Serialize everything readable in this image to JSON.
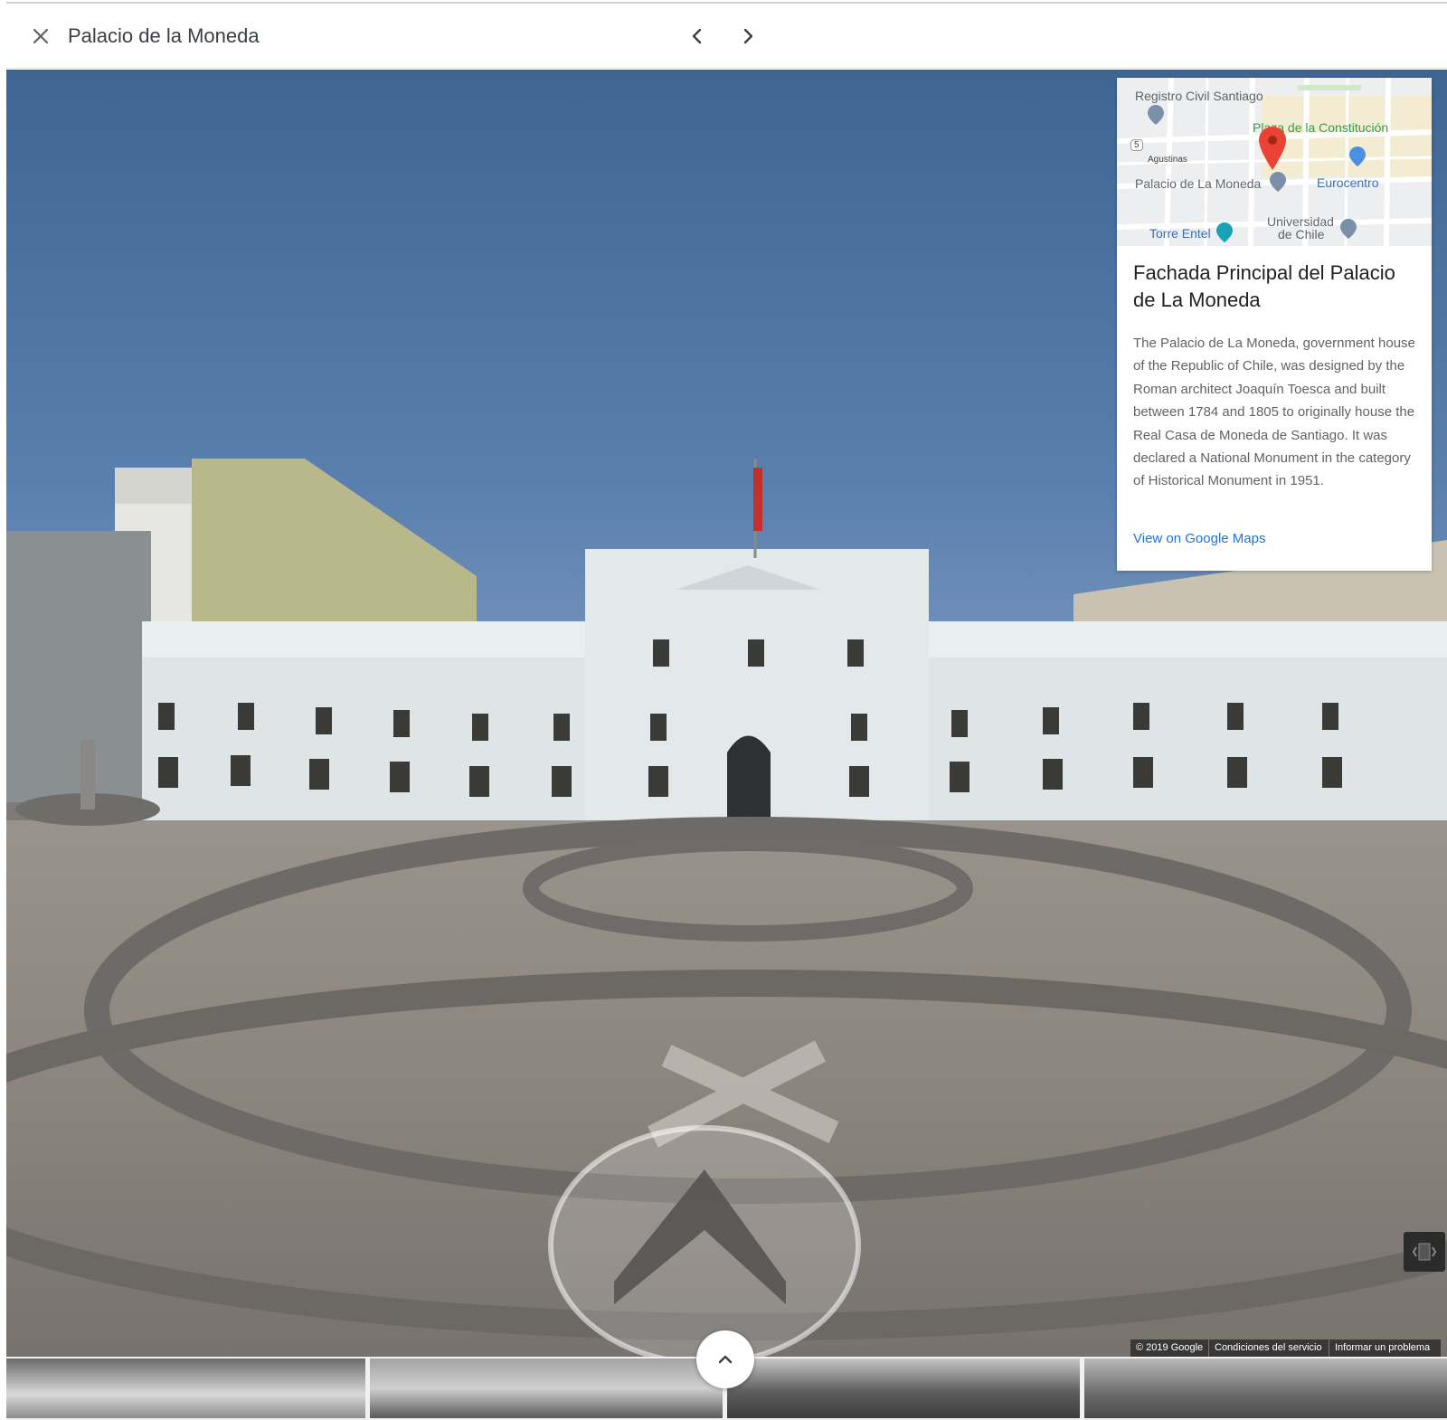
{
  "header": {
    "title": "Palacio de la Moneda"
  },
  "info_card": {
    "map_labels": {
      "registro": "Registro Civil Santiago",
      "plaza": "Plaza de la Constitución",
      "agustinas": "Agustinas",
      "palacio": "Palacio de La Moneda",
      "eurocentro": "Eurocentro",
      "universidad_line1": "Universidad",
      "universidad_line2": "de Chile",
      "torre": "Torre Entel",
      "route": "5"
    },
    "title": "Fachada Principal del Palacio de La Moneda",
    "description": "The Palacio de La Moneda, government house of the Republic of Chile, was designed by the Roman architect Joaquín Toesca and built between 1784 and 1805 to originally house the Real Casa de Moneda de Santiago. It was declared a National Monument in the category of Historical Monument in 1951.",
    "link": "View on Google Maps"
  },
  "footer": {
    "copyright": "© 2019 Google",
    "terms": "Condiciones del servicio",
    "report": "Informar un problema"
  },
  "colors": {
    "accent_link": "#1a73e8",
    "map_pin": "#ea4335",
    "map_green_label": "#2e9f48",
    "sky": "#4f74a3",
    "building": "#dfe4e7"
  }
}
